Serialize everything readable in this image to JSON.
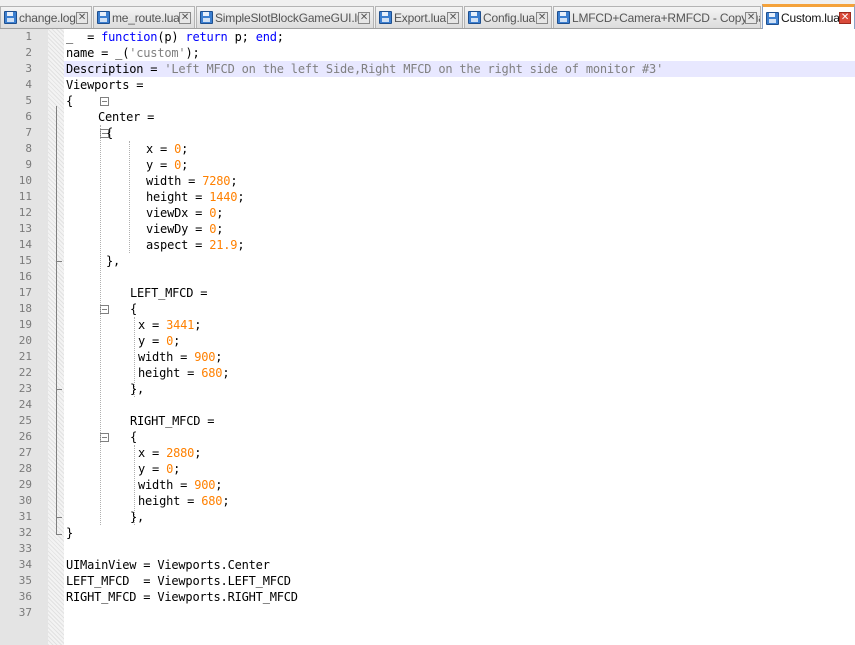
{
  "tabs": [
    {
      "label": "change.log",
      "active": false
    },
    {
      "label": "me_route.lua",
      "active": false
    },
    {
      "label": "SimpleSlotBlockGameGUI.lua",
      "active": false
    },
    {
      "label": "Export.lua",
      "active": false
    },
    {
      "label": "Config.lua",
      "active": false
    },
    {
      "label": "LMFCD+Camera+RMFCD - Copy.lua",
      "active": false
    },
    {
      "label": "Custom.lua",
      "active": true
    }
  ],
  "tab_icons": {
    "save": "save-disk-icon",
    "close": "close-x-icon",
    "close_glyph": "✕"
  },
  "editor": {
    "highlight_line": 3,
    "colors": {
      "keyword": "#0000ff",
      "number": "#ff8000",
      "string": "#808080",
      "current_line": "#e8e8ff",
      "active_tab_accent": "#f4a23b"
    },
    "lines": [
      {
        "n": "1",
        "indent": 0,
        "segs": [
          [
            "_  = ",
            ""
          ],
          [
            "function",
            "kw"
          ],
          [
            "(p) ",
            ""
          ],
          [
            "return",
            "kw"
          ],
          [
            " p; ",
            ""
          ],
          [
            "end",
            "kw"
          ],
          [
            ";",
            ""
          ]
        ]
      },
      {
        "n": "2",
        "indent": 0,
        "segs": [
          [
            "name = _(",
            ""
          ],
          [
            "'custom'",
            "str"
          ],
          [
            ");",
            ""
          ]
        ]
      },
      {
        "n": "3",
        "indent": 0,
        "segs": [
          [
            "Description = ",
            ""
          ],
          [
            "'Left MFCD on the left Side,Right MFCD on the right side of monitor #3'",
            "str"
          ]
        ]
      },
      {
        "n": "4",
        "indent": 0,
        "segs": [
          [
            "Viewports =",
            ""
          ]
        ]
      },
      {
        "n": "5",
        "indent": 0,
        "segs": [
          [
            "{",
            ""
          ]
        ]
      },
      {
        "n": "6",
        "indent": 4,
        "segs": [
          [
            "Center =",
            ""
          ]
        ]
      },
      {
        "n": "7",
        "indent": 5,
        "segs": [
          [
            "{",
            ""
          ]
        ]
      },
      {
        "n": "8",
        "indent": 10,
        "segs": [
          [
            "x = ",
            ""
          ],
          [
            "0",
            "num"
          ],
          [
            ";",
            ""
          ]
        ]
      },
      {
        "n": "9",
        "indent": 10,
        "segs": [
          [
            "y = ",
            ""
          ],
          [
            "0",
            "num"
          ],
          [
            ";",
            ""
          ]
        ]
      },
      {
        "n": "10",
        "indent": 10,
        "segs": [
          [
            "width = ",
            ""
          ],
          [
            "7280",
            "num"
          ],
          [
            ";",
            ""
          ]
        ]
      },
      {
        "n": "11",
        "indent": 10,
        "segs": [
          [
            "height = ",
            ""
          ],
          [
            "1440",
            "num"
          ],
          [
            ";",
            ""
          ]
        ]
      },
      {
        "n": "12",
        "indent": 10,
        "segs": [
          [
            "viewDx = ",
            ""
          ],
          [
            "0",
            "num"
          ],
          [
            ";",
            ""
          ]
        ]
      },
      {
        "n": "13",
        "indent": 10,
        "segs": [
          [
            "viewDy = ",
            ""
          ],
          [
            "0",
            "num"
          ],
          [
            ";",
            ""
          ]
        ]
      },
      {
        "n": "14",
        "indent": 10,
        "segs": [
          [
            "aspect = ",
            ""
          ],
          [
            "21.9",
            "num"
          ],
          [
            ";",
            ""
          ]
        ]
      },
      {
        "n": "15",
        "indent": 5,
        "segs": [
          [
            "},",
            ""
          ]
        ]
      },
      {
        "n": "16",
        "indent": 0,
        "segs": []
      },
      {
        "n": "17",
        "indent": 8,
        "segs": [
          [
            "LEFT_MFCD =",
            ""
          ]
        ]
      },
      {
        "n": "18",
        "indent": 8,
        "segs": [
          [
            "{",
            ""
          ]
        ]
      },
      {
        "n": "19",
        "indent": 9,
        "segs": [
          [
            "x = ",
            ""
          ],
          [
            "3441",
            "num"
          ],
          [
            ";",
            ""
          ]
        ]
      },
      {
        "n": "20",
        "indent": 9,
        "segs": [
          [
            "y = ",
            ""
          ],
          [
            "0",
            "num"
          ],
          [
            ";",
            ""
          ]
        ]
      },
      {
        "n": "21",
        "indent": 9,
        "segs": [
          [
            "width = ",
            ""
          ],
          [
            "900",
            "num"
          ],
          [
            ";",
            ""
          ]
        ]
      },
      {
        "n": "22",
        "indent": 9,
        "segs": [
          [
            "height = ",
            ""
          ],
          [
            "680",
            "num"
          ],
          [
            ";",
            ""
          ]
        ]
      },
      {
        "n": "23",
        "indent": 8,
        "segs": [
          [
            "},",
            ""
          ]
        ]
      },
      {
        "n": "24",
        "indent": 0,
        "segs": []
      },
      {
        "n": "25",
        "indent": 8,
        "segs": [
          [
            "RIGHT_MFCD =",
            ""
          ]
        ]
      },
      {
        "n": "26",
        "indent": 8,
        "segs": [
          [
            "{",
            ""
          ]
        ]
      },
      {
        "n": "27",
        "indent": 9,
        "segs": [
          [
            "x = ",
            ""
          ],
          [
            "2880",
            "num"
          ],
          [
            ";",
            ""
          ]
        ]
      },
      {
        "n": "28",
        "indent": 9,
        "segs": [
          [
            "y = ",
            ""
          ],
          [
            "0",
            "num"
          ],
          [
            ";",
            ""
          ]
        ]
      },
      {
        "n": "29",
        "indent": 9,
        "segs": [
          [
            "width = ",
            ""
          ],
          [
            "900",
            "num"
          ],
          [
            ";",
            ""
          ]
        ]
      },
      {
        "n": "30",
        "indent": 9,
        "segs": [
          [
            "height = ",
            ""
          ],
          [
            "680",
            "num"
          ],
          [
            ";",
            ""
          ]
        ]
      },
      {
        "n": "31",
        "indent": 8,
        "segs": [
          [
            "},",
            ""
          ]
        ]
      },
      {
        "n": "32",
        "indent": 0,
        "segs": [
          [
            "}",
            ""
          ]
        ]
      },
      {
        "n": "33",
        "indent": 0,
        "segs": []
      },
      {
        "n": "34",
        "indent": 0,
        "segs": [
          [
            "UIMainView = Viewports.Center",
            ""
          ]
        ]
      },
      {
        "n": "35",
        "indent": 0,
        "segs": [
          [
            "LEFT_MFCD  = Viewports.LEFT_MFCD",
            ""
          ]
        ]
      },
      {
        "n": "36",
        "indent": 0,
        "segs": [
          [
            "RIGHT_MFCD = Viewports.RIGHT_MFCD",
            ""
          ]
        ]
      },
      {
        "n": "37",
        "indent": 0,
        "segs": []
      }
    ]
  }
}
